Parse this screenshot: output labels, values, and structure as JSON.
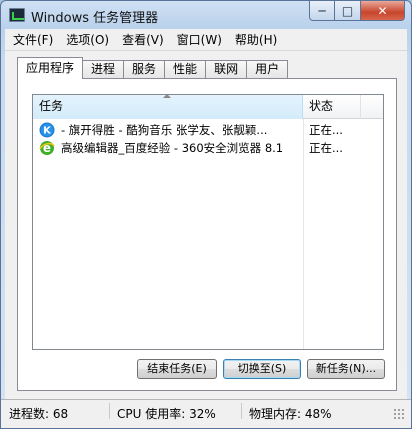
{
  "window": {
    "title": "Windows 任务管理器"
  },
  "menu": [
    {
      "label": "文件(F)"
    },
    {
      "label": "选项(O)"
    },
    {
      "label": "查看(V)"
    },
    {
      "label": "窗口(W)"
    },
    {
      "label": "帮助(H)"
    }
  ],
  "tabs": [
    {
      "label": "应用程序",
      "active": true
    },
    {
      "label": "进程"
    },
    {
      "label": "服务"
    },
    {
      "label": "性能"
    },
    {
      "label": "联网"
    },
    {
      "label": "用户"
    }
  ],
  "list": {
    "columns": {
      "task": "任务",
      "status": "状态"
    },
    "rows": [
      {
        "icon": "kugou-music-icon",
        "task": " - 旗开得胜 - 酷狗音乐 张学友、张靓颖...",
        "status": "正在..."
      },
      {
        "icon": "360-browser-icon",
        "task": "高级编辑器_百度经验 - 360安全浏览器 8.1",
        "status": "正在..."
      }
    ]
  },
  "buttons": {
    "end_task": "结束任务(E)",
    "switch_to": "切换至(S)",
    "new_task": "新任务(N)..."
  },
  "statusbar": {
    "processes": "进程数: 68",
    "cpu": "CPU 使用率: 32%",
    "memory": "物理内存: 48%"
  },
  "colors": {
    "accent": "#3c7fb1",
    "close": "#c8452c"
  }
}
